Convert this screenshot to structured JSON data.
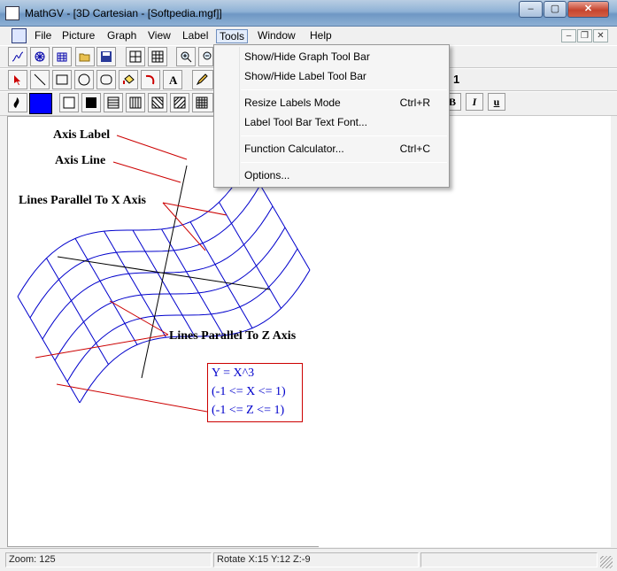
{
  "window": {
    "title": "MathGV - [3D Cartesian - [Softpedia.mgf]]",
    "minimize": "–",
    "maximize": "▢",
    "close": "✕"
  },
  "menu": {
    "items": [
      "File",
      "Picture",
      "Graph",
      "View",
      "Label",
      "Tools",
      "Window",
      "Help"
    ],
    "active": "Tools",
    "mdi": [
      "–",
      "❐",
      "✕"
    ]
  },
  "tools_menu": {
    "items": [
      {
        "label": "Show/Hide Graph Tool Bar",
        "shortcut": ""
      },
      {
        "label": "Show/Hide Label Tool Bar",
        "shortcut": ""
      },
      {
        "label": "Resize Labels Mode",
        "shortcut": "Ctrl+R"
      },
      {
        "label": "Label Tool Bar Text Font...",
        "shortcut": ""
      },
      {
        "label": "Function Calculator...",
        "shortcut": "Ctrl+C"
      },
      {
        "label": "Options...",
        "shortcut": ""
      }
    ]
  },
  "format_toolbar": {
    "size_tail": "1",
    "bold": "B",
    "italic": "I",
    "underline": "u"
  },
  "graph": {
    "labels": {
      "axis_label": "Axis Label",
      "axis_line": "Axis Line",
      "parallel_x": "Lines Parallel To X Axis",
      "parallel_z": "Lines Parallel To Z Axis"
    },
    "equation": [
      "Y = X^3",
      "(-1 <= X <= 1)",
      "(-1 <= Z <= 1)"
    ],
    "colors": {
      "surface": "#0000cc",
      "annotation": "#cc0000",
      "axis": "#000000"
    }
  },
  "status": {
    "zoom": "Zoom: 125",
    "rotate": "Rotate X:15 Y:12 Z:-9"
  }
}
